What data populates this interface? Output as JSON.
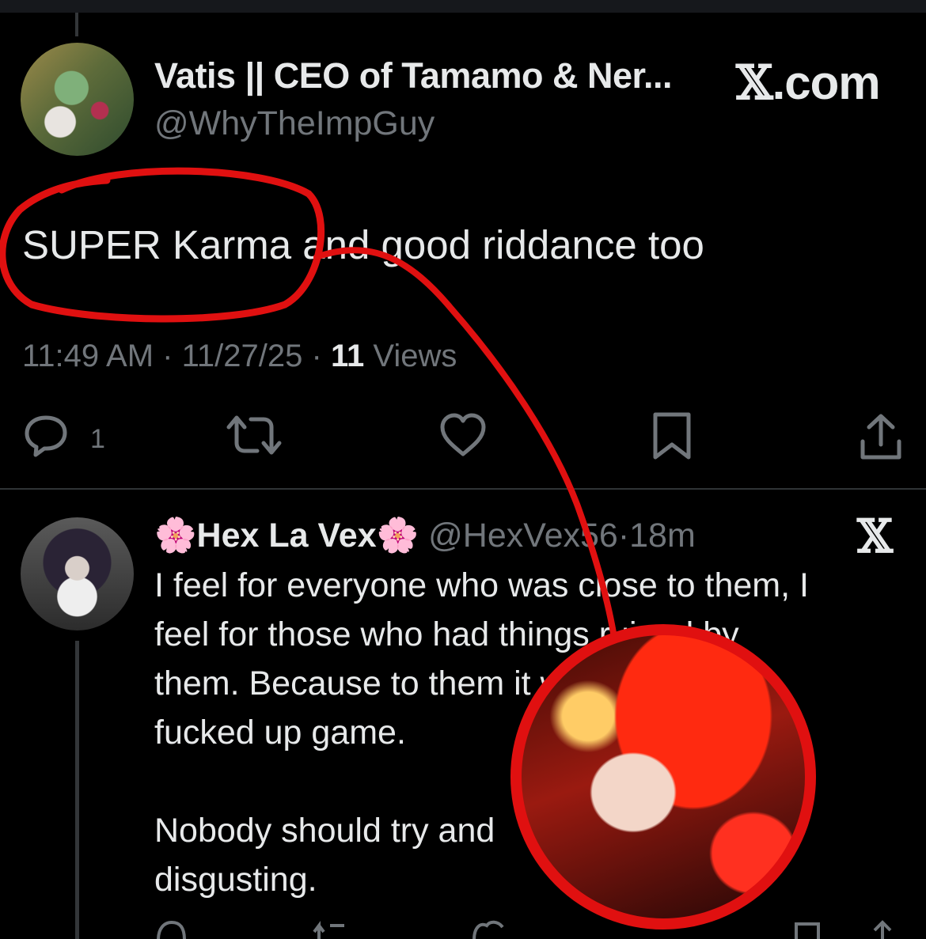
{
  "main_tweet": {
    "author_name": "Vatis || CEO of Tamamo & Ner...",
    "handle": "@WhyTheImpGuy",
    "text": "SUPER Karma and good riddance too",
    "time": "11:49 AM",
    "date": "11/27/25",
    "views_count": "11",
    "views_label": "Views",
    "reply_count": "1"
  },
  "watermark": {
    "x_glyph": "𝕏",
    "suffix": ".com"
  },
  "reply": {
    "emoji": "🌸",
    "author_name": "Hex La Vex",
    "handle": "@HexVex56",
    "age": "18m",
    "x_glyph": "𝕏",
    "lines": [
      "I feel for everyone who was close to them, I",
      "feel for those who had things ruined by",
      "them. Because to them it was some",
      "fucked up game.",
      "",
      "Nobody should try and",
      "disgusting."
    ]
  },
  "annotation": {
    "color": "#e01010"
  },
  "icons": [
    "reply-icon",
    "retweet-icon",
    "like-icon",
    "bookmark-icon",
    "share-icon",
    "avatar",
    "zoomed-avatar"
  ]
}
